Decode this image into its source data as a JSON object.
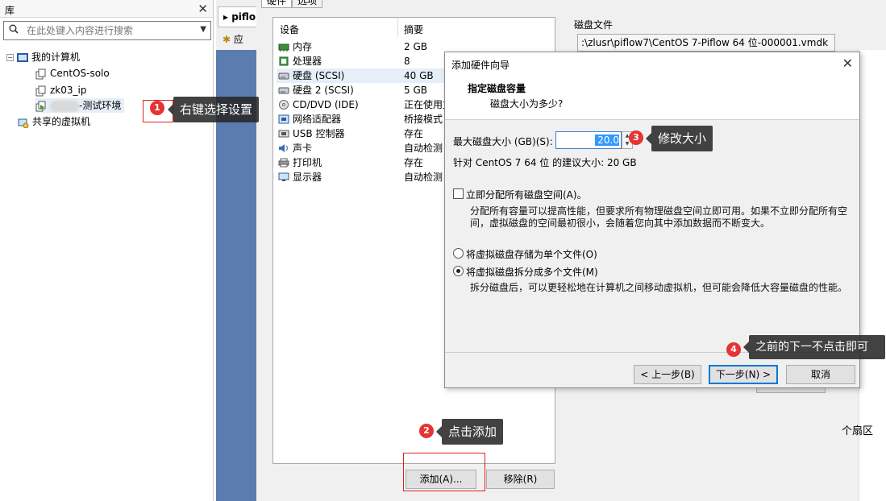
{
  "library": {
    "title": "库",
    "search_placeholder": "在此处键入内容进行搜索",
    "tree": {
      "root": "我的计算机",
      "vms": [
        "CentOS-solo",
        "zk03_ip",
        "-测试环境"
      ],
      "shared": "共享的虚拟机"
    }
  },
  "vm_tab": {
    "title": "piflo",
    "subtab": "应"
  },
  "settings": {
    "tabs": [
      "硬件",
      "选项"
    ],
    "columns": {
      "device": "设备",
      "summary": "摘要"
    },
    "devices": [
      {
        "name": "内存",
        "summary": "2 GB",
        "icon": "memory-icon"
      },
      {
        "name": "处理器",
        "summary": "8",
        "icon": "processor-icon"
      },
      {
        "name": "硬盘 (SCSI)",
        "summary": "40 GB",
        "icon": "harddisk-icon"
      },
      {
        "name": "硬盘 2 (SCSI)",
        "summary": "5 GB",
        "icon": "harddisk-icon"
      },
      {
        "name": "CD/DVD (IDE)",
        "summary": "正在使用文",
        "icon": "cd-icon"
      },
      {
        "name": "网络适配器",
        "summary": "桥接模式",
        "icon": "network-icon"
      },
      {
        "name": "USB 控制器",
        "summary": "存在",
        "icon": "usb-icon"
      },
      {
        "name": "声卡",
        "summary": "自动检测",
        "icon": "sound-icon"
      },
      {
        "name": "打印机",
        "summary": "存在",
        "icon": "printer-icon"
      },
      {
        "name": "显示器",
        "summary": "自动检测",
        "icon": "display-icon"
      }
    ],
    "add_button": "添加(A)...",
    "remove_button": "移除(R)",
    "disk_file_label": "磁盘文件",
    "disk_file_path": ":\\zlusr\\piflow7\\CentOS 7-Piflow 64 位-000001.vmdk",
    "sectors_text": "个扇区"
  },
  "wizard": {
    "title": "添加硬件向导",
    "heading": "指定磁盘容量",
    "subheading": "磁盘大小为多少?",
    "max_size_label": "最大磁盘大小 (GB)(S):",
    "max_size_value": "20.0",
    "recommended": "针对 CentOS 7 64 位 的建议大小: 20 GB",
    "allocate_now_label": "立即分配所有磁盘空间(A)。",
    "allocate_desc_1": "分配所有容量可以提高性能，但要求所有物理磁盘空间立即可用。如果不立即分配所有空",
    "allocate_desc_2": "间，虚拟磁盘的空间最初很小，会随着您向其中添加数据而不断变大。",
    "single_file_label": "将虚拟磁盘存储为单个文件(O)",
    "multi_file_label": "将虚拟磁盘拆分成多个文件(M)",
    "multi_file_desc": "拆分磁盘后，可以更轻松地在计算机之间移动虚拟机，但可能会降低大容量磁盘的性能。",
    "back_button": "< 上一步(B)",
    "next_button": "下一步(N) >",
    "cancel_button": "取消"
  },
  "annotations": [
    {
      "number": "1",
      "text": "右键选择设置"
    },
    {
      "number": "2",
      "text": "点击添加"
    },
    {
      "number": "3",
      "text": "修改大小"
    },
    {
      "number": "4",
      "text": "之前的下一不点击即可"
    }
  ],
  "colors": {
    "annotation_red": "#e63333",
    "tooltip_bg": "#282828",
    "selection_blue": "#3399ff"
  }
}
